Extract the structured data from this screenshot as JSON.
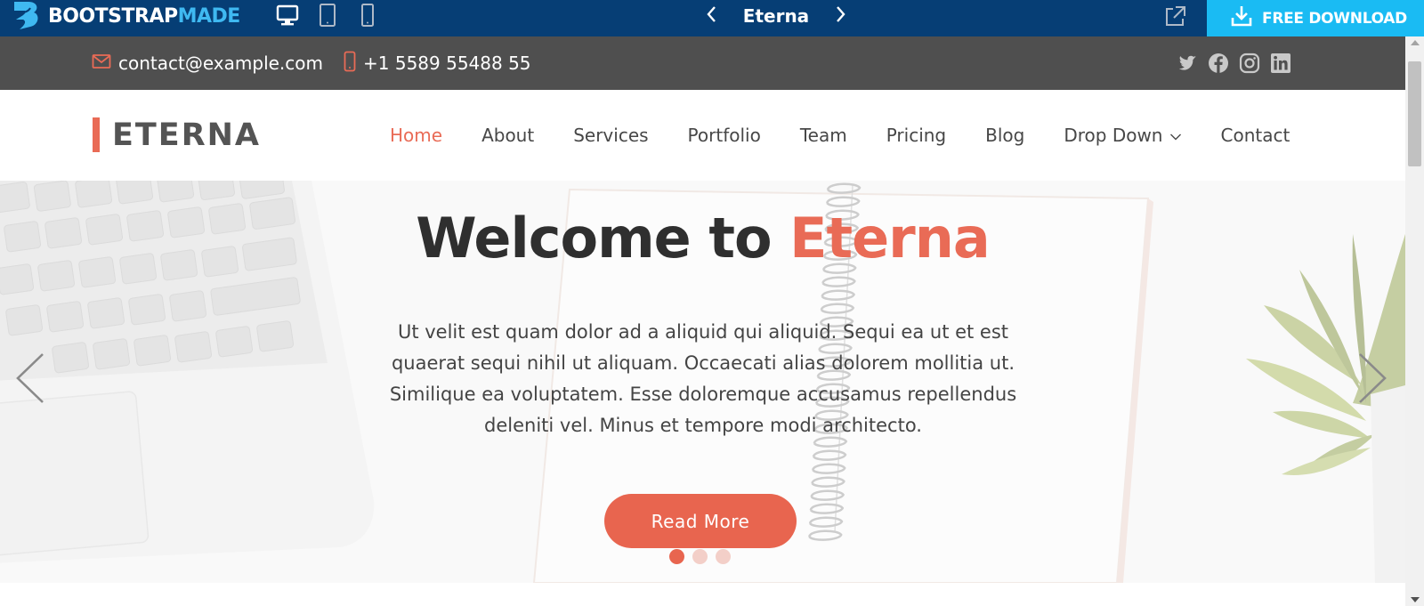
{
  "bootstrapmade_bar": {
    "logo_text_main": "BOOTSTRAP",
    "logo_text_accent": "MADE",
    "devices": [
      "desktop-icon",
      "tablet-icon",
      "mobile-icon"
    ],
    "template_title": "Eterna",
    "download_label": "FREE DOWNLOAD",
    "colors": {
      "bar": "#063e75",
      "download": "#1abbf3",
      "logo_accent": "#3fb9f1"
    }
  },
  "topbar": {
    "email": "contact@example.com",
    "phone": "+1 5589 55488 55",
    "social": [
      "twitter-icon",
      "facebook-icon",
      "instagram-icon",
      "linkedin-icon"
    ]
  },
  "header": {
    "brand": "ETERNA",
    "nav": [
      {
        "label": "Home",
        "active": true
      },
      {
        "label": "About"
      },
      {
        "label": "Services"
      },
      {
        "label": "Portfolio"
      },
      {
        "label": "Team"
      },
      {
        "label": "Pricing"
      },
      {
        "label": "Blog"
      },
      {
        "label": "Drop Down",
        "dropdown": true
      },
      {
        "label": "Contact"
      }
    ],
    "accent_color": "#e96b56"
  },
  "hero": {
    "title_prefix": "Welcome to",
    "title_accent": "Eterna",
    "text": "Ut velit est quam dolor ad a aliquid qui aliquid. Sequi ea ut et est quaerat sequi nihil ut aliquam. Occaecati alias dolorem mollitia ut. Similique ea voluptatem. Esse doloremque accusamus repellendus deleniti vel. Minus et tempore modi architecto.",
    "button_label": "Read More",
    "slides_total": 3,
    "active_slide": 1
  }
}
